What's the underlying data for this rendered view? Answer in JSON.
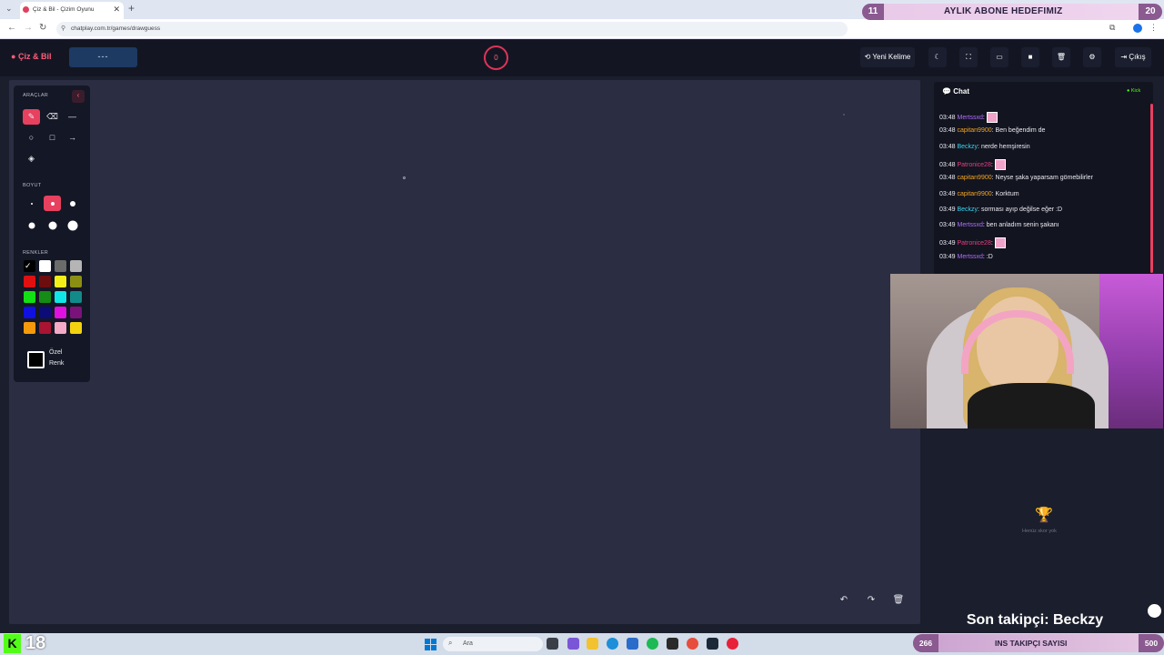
{
  "browser": {
    "tab_title": "Çiz & Bil - Çizim Oyunu",
    "tab_close": "✕",
    "new_tab": "+",
    "url": "chatplay.com.tr/games/drawguess"
  },
  "overlays": {
    "sub_goal": {
      "current": "11",
      "label": "AYLIK ABONE HEDEFIMIZ",
      "target": "20"
    },
    "last_follower": "Son takipçi: Beckzy",
    "insta_goal": {
      "current": "266",
      "label": "INS TAKIPÇI SAYISI",
      "target": "500"
    },
    "viewer_count": "18",
    "kick_badge": "K"
  },
  "app": {
    "logo": "Çiz & Bil",
    "word_placeholder": "---",
    "timer": "0",
    "buttons": {
      "new_word": "Yeni Kelime",
      "exit": "Çıkış"
    }
  },
  "tools": {
    "section_tools": "ARAÇLAR",
    "section_size": "BOYUT",
    "section_colors": "RENKLER",
    "custom_color_line1": "Özel",
    "custom_color_line2": "Renk",
    "colors": [
      "#000000",
      "#ffffff",
      "#6b6b6b",
      "#b5b5b5",
      "#e01010",
      "#6e0d0d",
      "#f1ee18",
      "#8a8f14",
      "#13e013",
      "#158c15",
      "#11e6e6",
      "#138a8a",
      "#1010e0",
      "#0c0c78",
      "#e010e0",
      "#7a127a",
      "#f59a0a",
      "#a81432",
      "#f4a9c6",
      "#f3d20f"
    ]
  },
  "chat": {
    "title": "Chat",
    "platform": "Kick",
    "messages": [
      {
        "time": "03:48",
        "user": "Mertssxd",
        "user_color": "#b06dff",
        "text": "",
        "emote": true
      },
      {
        "time": "03:48",
        "user": "capitan9900",
        "user_color": "#f5a623",
        "text": "Ben beğendim de",
        "emote": false
      },
      {
        "time": "03:48",
        "user": "Beckzy",
        "user_color": "#38d6f0",
        "text": "nerde hemşiresin",
        "emote": false
      },
      {
        "time": "03:48",
        "user": "Patronice28",
        "user_color": "#e83f80",
        "text": "",
        "emote": true
      },
      {
        "time": "03:48",
        "user": "capitan9900",
        "user_color": "#f5a623",
        "text": "Neyse şaka yaparsam gömebilirler",
        "emote": false
      },
      {
        "time": "03:49",
        "user": "capitan9900",
        "user_color": "#f5a623",
        "text": "Korktum",
        "emote": false
      },
      {
        "time": "03:49",
        "user": "Beckzy",
        "user_color": "#38d6f0",
        "text": "sorması ayıp değilse eğer :D",
        "emote": false
      },
      {
        "time": "03:49",
        "user": "Mertssxd",
        "user_color": "#b06dff",
        "text": "ben anladım senin şakanı",
        "emote": false
      },
      {
        "time": "03:49",
        "user": "Patronice28",
        "user_color": "#e83f80",
        "text": "",
        "emote": true
      },
      {
        "time": "03:49",
        "user": "Mertssxd",
        "user_color": "#b06dff",
        "text": ":D",
        "emote": false
      }
    ]
  },
  "scoreboard": {
    "empty_text": "Henüz skor yok"
  },
  "taskbar": {
    "search_placeholder": "Ara"
  }
}
